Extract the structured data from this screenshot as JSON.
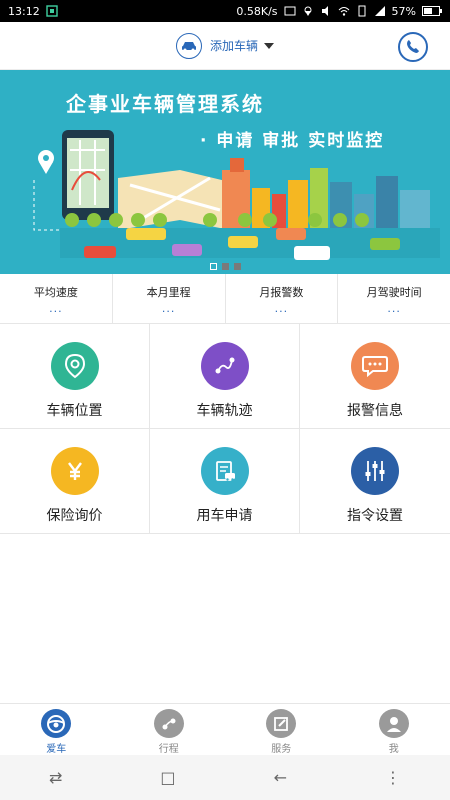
{
  "status_bar": {
    "time": "13:12",
    "speed": "0.58K/s",
    "battery": "57%"
  },
  "header": {
    "add_vehicle_label": "添加车辆",
    "accent_color": "#2a68b8"
  },
  "banner": {
    "title": "企事业车辆管理系统",
    "subtitle": "· 申请 审批 实时监控",
    "background_color": "#2fb0c5"
  },
  "stats": [
    {
      "label": "平均速度",
      "value": "..."
    },
    {
      "label": "本月里程",
      "value": "..."
    },
    {
      "label": "月报警数",
      "value": "..."
    },
    {
      "label": "月驾驶时间",
      "value": "..."
    }
  ],
  "features": [
    {
      "label": "车辆位置",
      "icon": "location-pin-icon",
      "color": "#2fb594"
    },
    {
      "label": "车辆轨迹",
      "icon": "route-icon",
      "color": "#7e4fc7"
    },
    {
      "label": "报警信息",
      "icon": "chat-bubble-icon",
      "color": "#f08852"
    },
    {
      "label": "保险询价",
      "icon": "yen-icon",
      "color": "#f5b722"
    },
    {
      "label": "用车申请",
      "icon": "car-document-icon",
      "color": "#36b0c9"
    },
    {
      "label": "指令设置",
      "icon": "sliders-icon",
      "color": "#2b5fa6"
    }
  ],
  "tabs": [
    {
      "label": "爱车",
      "icon": "steering-wheel-icon",
      "active": true
    },
    {
      "label": "行程",
      "icon": "trip-icon",
      "active": false
    },
    {
      "label": "服务",
      "icon": "edit-icon",
      "active": false
    },
    {
      "label": "我",
      "icon": "user-icon",
      "active": false
    }
  ],
  "nav_bar": {
    "switch": "⇄",
    "home": "□",
    "back": "←",
    "menu": "⋮"
  }
}
